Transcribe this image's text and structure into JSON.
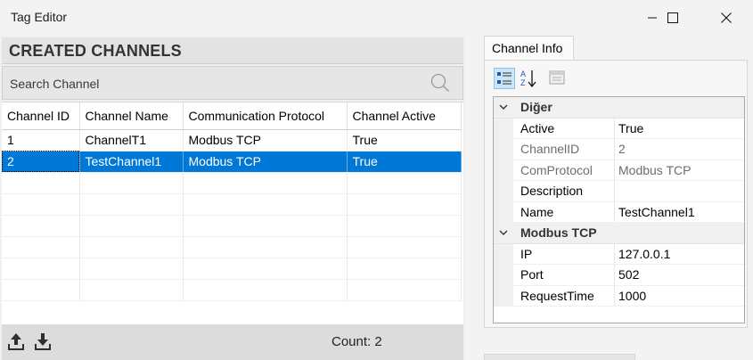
{
  "window": {
    "title": "Tag Editor",
    "controls": [
      "minimize-icon",
      "maximize-icon",
      "close-icon"
    ]
  },
  "left_panel": {
    "header": "CREATED CHANNELS",
    "search": {
      "placeholder": "Search Channel",
      "value": "",
      "icon": "search-icon"
    },
    "table": {
      "columns": [
        "Channel ID",
        "Channel Name",
        "Communication Protocol",
        "Channel Active"
      ],
      "rows": [
        {
          "id": "1",
          "name": "ChannelT1",
          "protocol": "Modbus TCP",
          "active": "True",
          "selected": false
        },
        {
          "id": "2",
          "name": "TestChannel1",
          "protocol": "Modbus TCP",
          "active": "True",
          "selected": true
        }
      ]
    },
    "footer": {
      "count_label": "Count: 2",
      "icons": [
        "upload-icon",
        "download-icon"
      ]
    }
  },
  "right_panel": {
    "tab_label": "Channel Info",
    "toolbar_icons": [
      "categorized-icon",
      "alphabetical-sort-icon",
      "property-pages-icon"
    ],
    "categories": [
      {
        "label": "Diğer",
        "properties": [
          {
            "name": "Active",
            "value": "True",
            "readonly": false
          },
          {
            "name": "ChannelID",
            "value": "2",
            "readonly": true
          },
          {
            "name": "ComProtocol",
            "value": "Modbus TCP",
            "readonly": true
          },
          {
            "name": "Description",
            "value": "",
            "readonly": false
          },
          {
            "name": "Name",
            "value": "TestChannel1",
            "readonly": false
          }
        ]
      },
      {
        "label": "Modbus TCP",
        "properties": [
          {
            "name": "IP",
            "value": "127.0.0.1",
            "readonly": false
          },
          {
            "name": "Port",
            "value": "502",
            "readonly": false
          },
          {
            "name": "RequestTime",
            "value": "1000",
            "readonly": false
          }
        ]
      }
    ]
  },
  "colors": {
    "selection": "#0078d7",
    "header_bg": "#e3e3e3",
    "footer_bg": "#dcdcdc"
  }
}
